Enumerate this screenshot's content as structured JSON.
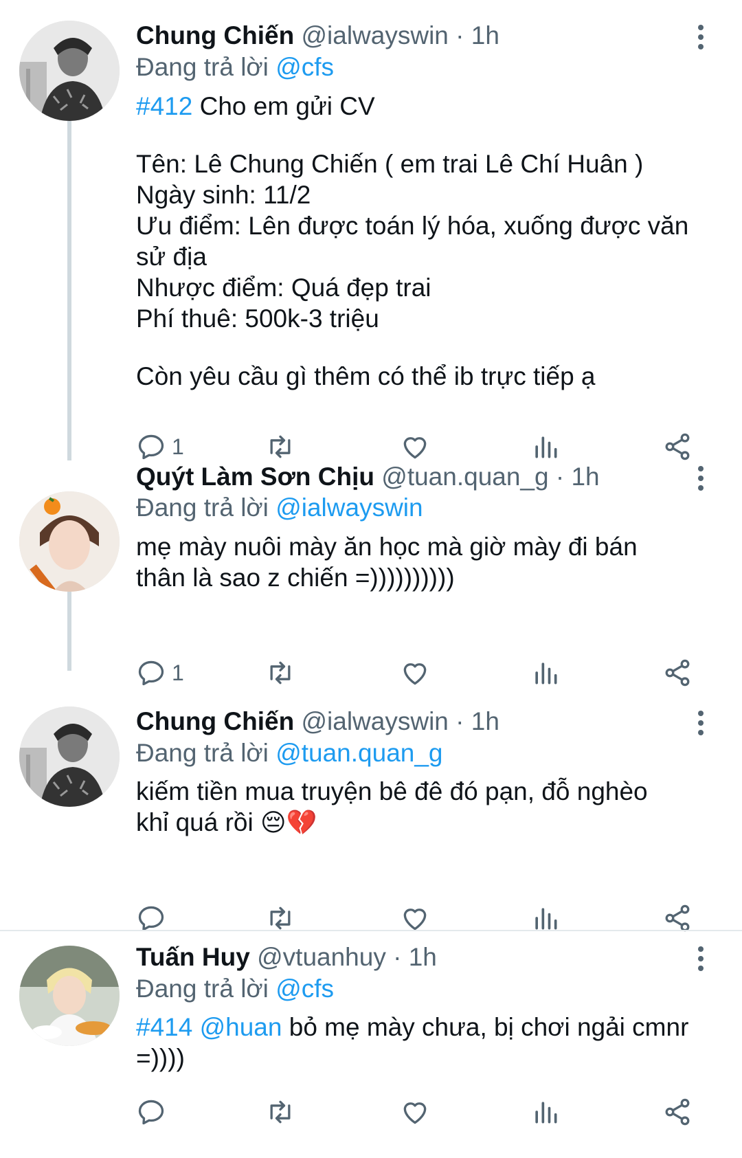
{
  "tweets": [
    {
      "name": "Chung Chiến",
      "handle": "@ialwayswin",
      "time": "· 1h",
      "replying_prefix": "Đang trả lời",
      "replying_to": "@cfs",
      "tag": "#412",
      "text_line1": " Cho em gửi CV",
      "lines": [
        "Tên: Lê Chung Chiến ( em trai Lê Chí Huân )",
        "Ngày sinh: 11/2",
        "Ưu điểm: Lên được toán lý hóa, xuống được văn sử địa",
        "Nhược điểm: Quá đẹp trai",
        "Phí thuê: 500k-3 triệu"
      ],
      "closing": "Còn yêu cầu gì thêm có thể ib trực tiếp ạ",
      "reply_count": "1"
    },
    {
      "name": "Quýt Làm Sơn Chịu",
      "handle": "@tuan.quan_g",
      "time": "· 1h",
      "replying_prefix": "Đang trả lời",
      "replying_to": "@ialwayswin",
      "text": "mẹ mày nuôi mày ăn học mà giờ mày đi bán thân là sao z chiến =))))))))))",
      "reply_count": "1"
    },
    {
      "name": "Chung Chiến",
      "handle": "@ialwayswin",
      "time": "· 1h",
      "replying_prefix": "Đang trả lời",
      "replying_to": "@tuan.quan_g",
      "text": "kiếm tiền mua truyện bê đê đó pạn, đỗ nghèo khỉ quá rồi",
      "emoji": "😔💔",
      "reply_count": ""
    },
    {
      "name": "Tuấn Huy",
      "handle": "@vtuanhuy",
      "time": "· 1h",
      "replying_prefix": "Đang trả lời",
      "replying_to": "@cfs",
      "tag": "#414",
      "mention": "@huan",
      "text": " bỏ mẹ mày chưa, bị chơi ngải cmnr =))))",
      "reply_count": ""
    }
  ],
  "icons": [
    "reply-icon",
    "retweet-icon",
    "like-icon",
    "analytics-icon",
    "share-icon",
    "more-icon"
  ],
  "colors": {
    "link": "#1d9bf0",
    "secondary": "#536471",
    "text": "#0f1419",
    "thread_line": "#cfd9de"
  }
}
